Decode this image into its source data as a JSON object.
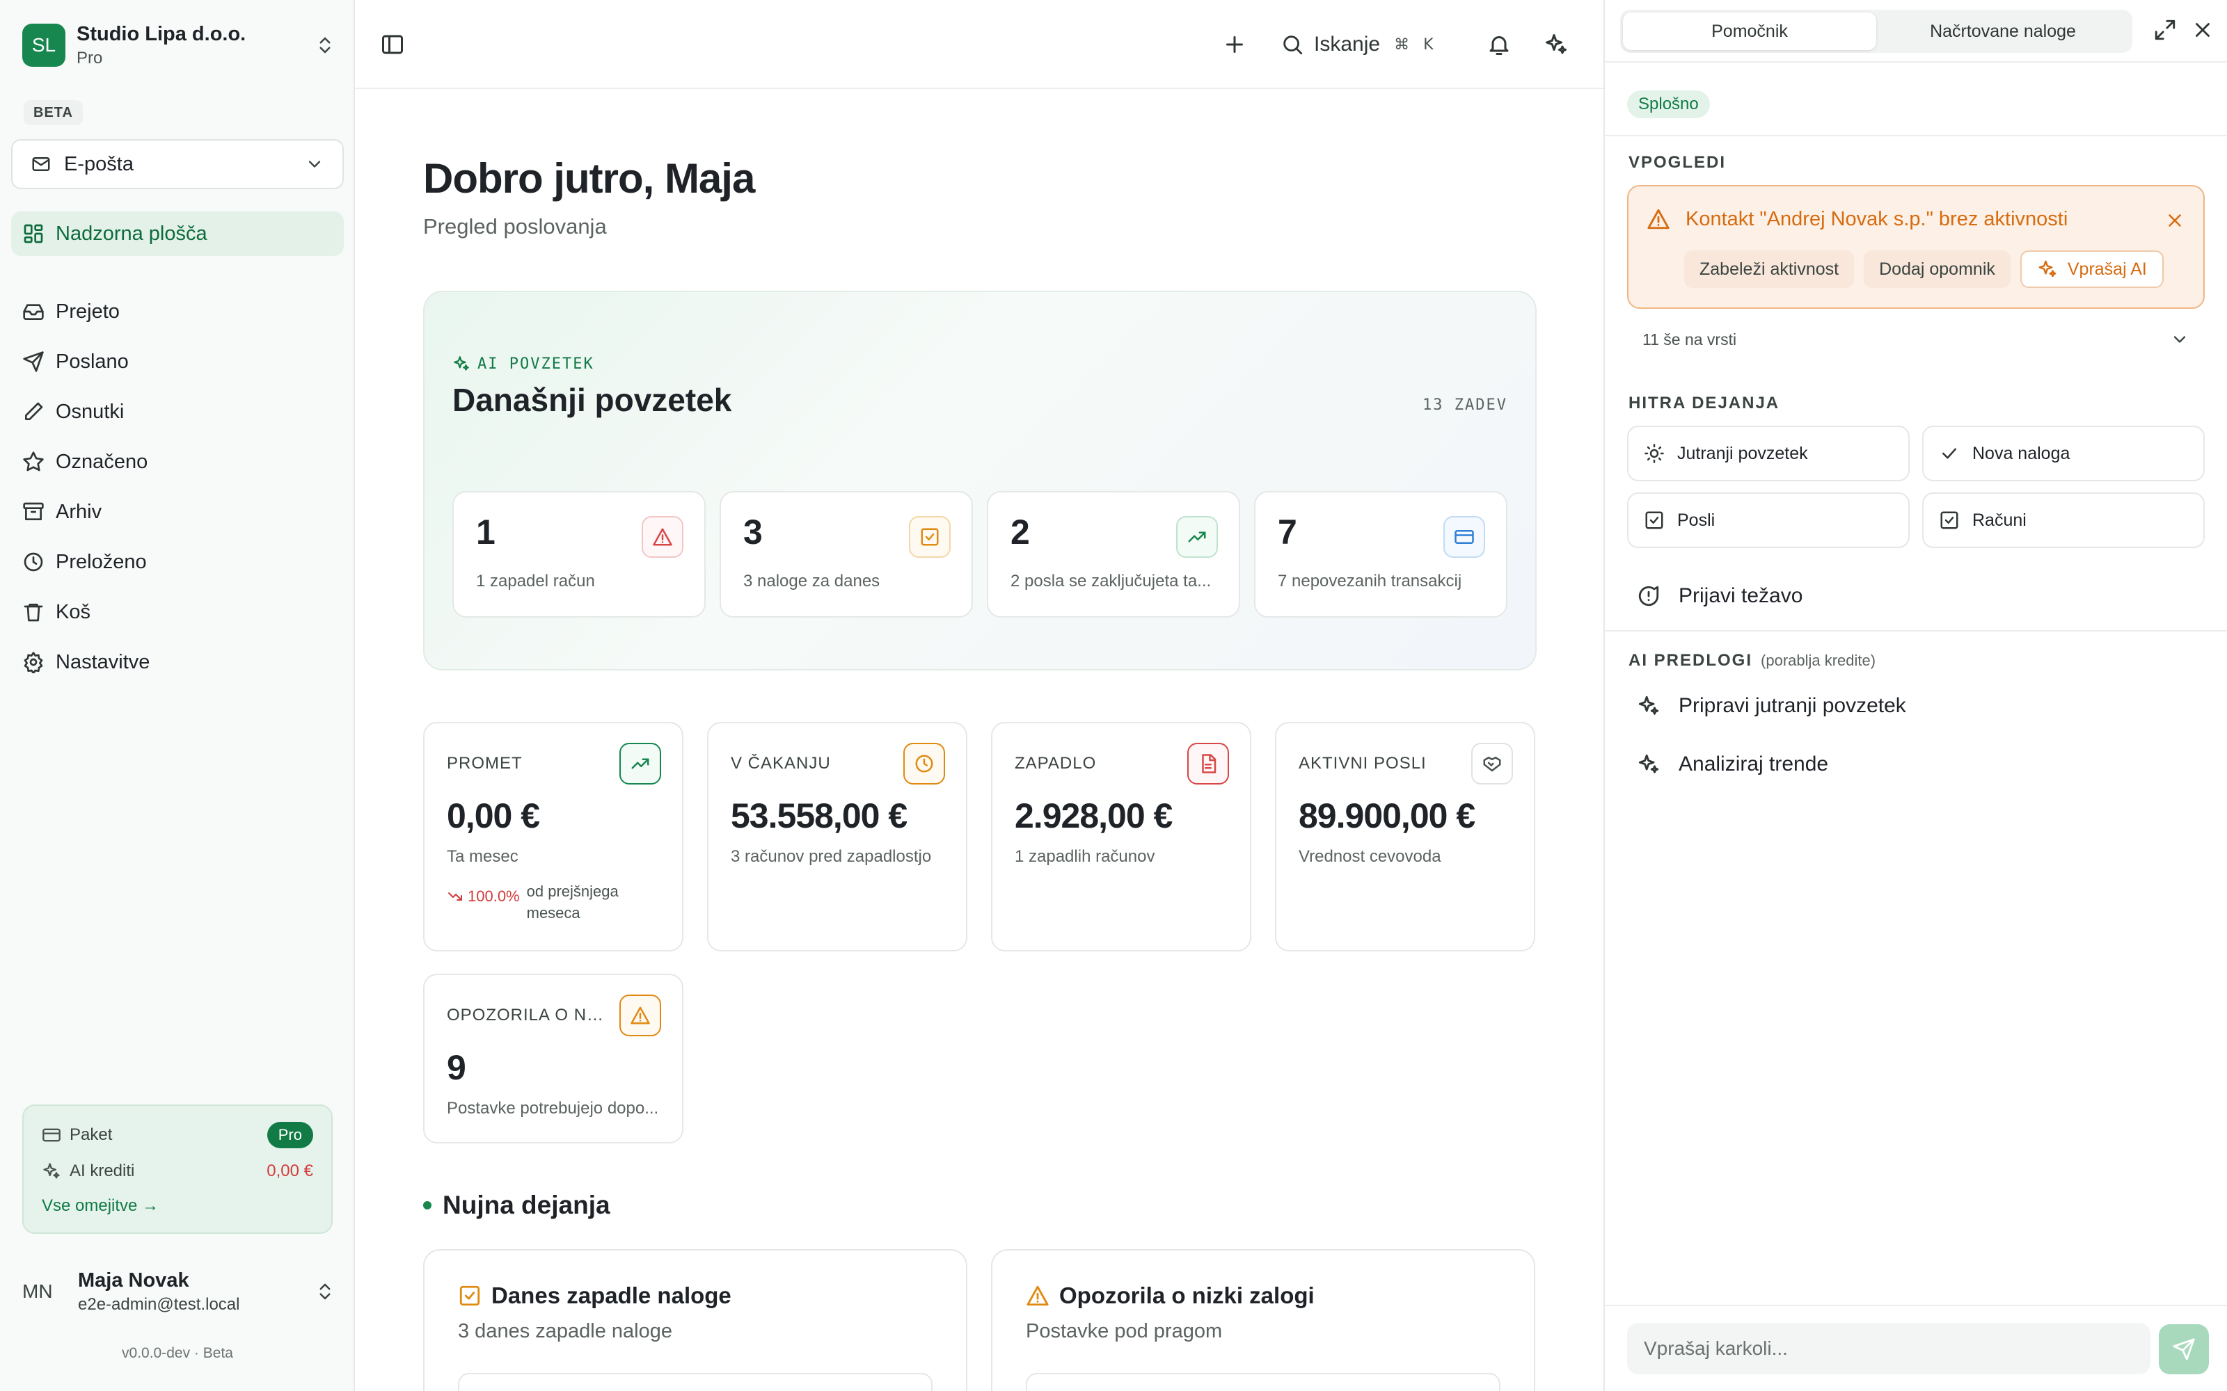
{
  "sidebar": {
    "org": {
      "initials": "SL",
      "name": "Studio Lipa d.o.o.",
      "plan": "Pro"
    },
    "beta_label": "BETA",
    "mailbox_select": "E-pošta",
    "nav_active": {
      "label": "Nadzorna plošča",
      "icon": "dashboard-icon"
    },
    "nav": [
      {
        "label": "Prejeto",
        "icon": "inbox-icon"
      },
      {
        "label": "Poslano",
        "icon": "send-icon"
      },
      {
        "label": "Osnutki",
        "icon": "pencil-icon"
      },
      {
        "label": "Označeno",
        "icon": "star-icon"
      },
      {
        "label": "Arhiv",
        "icon": "archive-icon"
      },
      {
        "label": "Preloženo",
        "icon": "clock-icon"
      },
      {
        "label": "Koš",
        "icon": "trash-icon"
      },
      {
        "label": "Nastavitve",
        "icon": "settings-icon"
      }
    ],
    "plan_box": {
      "package_label": "Paket",
      "package_value": "Pro",
      "credits_label": "AI krediti",
      "credits_value": "0,00 €",
      "limits_link": "Vse omejitve →"
    },
    "user": {
      "initials": "MN",
      "name": "Maja Novak",
      "email": "e2e-admin@test.local"
    },
    "version": "v0.0.0-dev · Beta"
  },
  "topbar": {
    "search_label": "Iskanje",
    "search_shortcut_mod": "⌘",
    "search_shortcut_key": "K"
  },
  "main": {
    "greeting": "Dobro jutro, Maja",
    "subtitle": "Pregled poslovanja",
    "summary": {
      "tag": "AI POVZETEK",
      "title": "Današnji povzetek",
      "count": "13 ZADEV",
      "cards": [
        {
          "number": "1",
          "label": "1 zapadel račun",
          "icon": "alert-triangle-icon",
          "tone": "red"
        },
        {
          "number": "3",
          "label": "3 naloge za danes",
          "icon": "check-square-icon",
          "tone": "orange"
        },
        {
          "number": "2",
          "label": "2 posla se zaključujeta ta...",
          "icon": "trending-up-icon",
          "tone": "green"
        },
        {
          "number": "7",
          "label": "7 nepovezanih transakcij",
          "icon": "credit-card-icon",
          "tone": "blue"
        }
      ]
    },
    "kpis": [
      {
        "title": "PROMET",
        "value": "0,00 €",
        "sub": "Ta mesec",
        "icon": "trending-up-icon",
        "tone": "green",
        "trend_pct": "100.0%",
        "trend_text": "od prejšnjega meseca"
      },
      {
        "title": "V ČAKANJU",
        "value": "53.558,00 €",
        "sub": "3 računov pred zapadlostjo",
        "icon": "clock-icon",
        "tone": "orange"
      },
      {
        "title": "ZAPADLO",
        "value": "2.928,00 €",
        "sub": "1 zapadlih računov",
        "icon": "file-text-icon",
        "tone": "red"
      },
      {
        "title": "AKTIVNI POSLI",
        "value": "89.900,00 €",
        "sub": "Vrednost cevovoda",
        "icon": "handshake-icon",
        "tone": "neutral"
      },
      {
        "title": "OPOZORILA O NIZ...",
        "value": "9",
        "sub": "Postavke potrebujejo dopo...",
        "icon": "alert-triangle-icon",
        "tone": "orange"
      }
    ],
    "urgent": {
      "heading": "Nujna dejanja",
      "cards": [
        {
          "title": "Danes zapadle naloge",
          "sub": "3 danes zapadle naloge",
          "icon": "check-square-icon"
        },
        {
          "title": "Opozorila o nizki zalogi",
          "sub": "Postavke pod pragom",
          "icon": "alert-triangle-icon"
        }
      ]
    }
  },
  "panel": {
    "tabs": [
      "Pomočnik",
      "Načrtovane naloge"
    ],
    "category_chip": "Splošno",
    "insights_label": "VPOGLEDI",
    "insight": {
      "title": "Kontakt \"Andrej Novak s.p.\" brez aktivnosti",
      "actions": [
        "Zabeleži aktivnost",
        "Dodaj opomnik"
      ],
      "ai_action": "Vprašaj AI"
    },
    "queue_text": "11 še na vrsti",
    "quick_label": "HITRA DEJANJA",
    "quick_actions": [
      {
        "label": "Jutranji povzetek",
        "icon": "sun-icon"
      },
      {
        "label": "Nova naloga",
        "icon": "check-icon"
      },
      {
        "label": "Posli",
        "icon": "check-square-icon"
      },
      {
        "label": "Računi",
        "icon": "check-square-icon"
      }
    ],
    "report_issue": "Prijavi težavo",
    "prompts_label": "AI PREDLOGI",
    "prompts_note": "(porablja kredite)",
    "prompts": [
      "Pripravi jutranji povzetek",
      "Analiziraj trende"
    ],
    "input_placeholder": "Vprašaj karkoli..."
  },
  "colors": {
    "accent": "#17864f",
    "danger": "#d43c3c",
    "warning": "#d66b0f",
    "info": "#2f7fd6"
  }
}
